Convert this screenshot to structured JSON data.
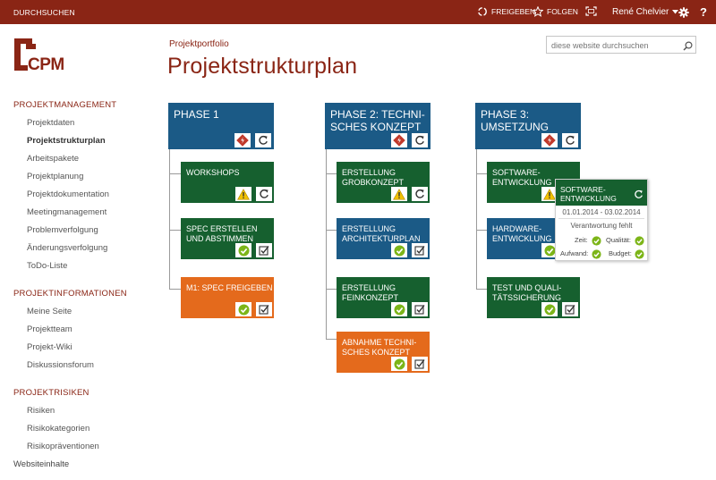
{
  "topbar": {
    "browse_label": "DURCHSUCHEN",
    "share_label": "FREIGEBEN",
    "follow_label": "FOLGEN",
    "user_name": "René Chelvier",
    "help_label": "?"
  },
  "logo": {
    "text": "CPM"
  },
  "header": {
    "breadcrumb": "Projektportfolio",
    "title": "Projektstrukturplan"
  },
  "search": {
    "placeholder": "diese website durchsuchen"
  },
  "nav": {
    "sections": [
      {
        "heading": "PROJEKTMANAGEMENT",
        "items": [
          "Projektdaten",
          "Projektstrukturplan",
          "Arbeitspakete",
          "Projektplanung",
          "Projektdokumentation",
          "Meetingmanagement",
          "Problemverfolgung",
          "Änderungsverfolgung",
          "ToDo-Liste"
        ]
      },
      {
        "heading": "PROJEKTINFORMATIONEN",
        "items": [
          "Meine Seite",
          "Projektteam",
          "Projekt-Wiki",
          "Diskussionsforum"
        ]
      },
      {
        "heading": "PROJEKTRISIKEN",
        "items": [
          "Risiken",
          "Risikokategorien",
          "Risikopräventionen"
        ]
      }
    ],
    "site_contents": "Websiteinhalte"
  },
  "wbs": {
    "phases": [
      {
        "line1": "PHASE 1",
        "line2": "",
        "packages": [
          {
            "line1": "WORKSHOPS",
            "line2": "",
            "color": "green",
            "status": "warning"
          },
          {
            "line1": "SPEC ERSTELLEN",
            "line2": "UND ABSTIMMEN",
            "color": "green",
            "status": "check"
          },
          {
            "line1": "M1: SPEC FREIGEBEN",
            "line2": "",
            "color": "orange",
            "status": "check"
          }
        ]
      },
      {
        "line1": "PHASE 2: TECHNI-",
        "line2": "SCHES KONZEPT",
        "packages": [
          {
            "line1": "ERSTELLUNG",
            "line2": "GROBKONZEPT",
            "color": "green",
            "status": "warning"
          },
          {
            "line1": "ERSTELLUNG",
            "line2": "ARCHITEKTURPLAN",
            "color": "blue",
            "status": "check"
          },
          {
            "line1": "ERSTELLUNG",
            "line2": "FEINKONZEPT",
            "color": "green",
            "status": "check"
          },
          {
            "line1": "ABNAHME TECHNI-",
            "line2": "SCHES KONZEPT",
            "color": "orange",
            "status": "check"
          }
        ]
      },
      {
        "line1": "PHASE 3:",
        "line2": "UMSETZUNG",
        "packages": [
          {
            "line1": "SOFTWARE-",
            "line2": "ENTWICKLUNG",
            "color": "green",
            "status": "warning"
          },
          {
            "line1": "HARDWARE-",
            "line2": "ENTWICKLUNG",
            "color": "blue",
            "status": "check"
          },
          {
            "line1": "TEST UND QUALI-",
            "line2": "TÄTSSICHERUNG",
            "color": "green",
            "status": "check"
          }
        ]
      }
    ]
  },
  "popup": {
    "title_line1": "SOFTWARE-",
    "title_line2": "ENTWICKLUNG",
    "dates": "01.01.2014 - 03.02.2014",
    "responsibility": "Verantwortung fehlt",
    "time_label": "Zeit:",
    "quality_label": "Qualität:",
    "effort_label": "Aufwand:",
    "budget_label": "Budget:"
  },
  "colors": {
    "brand": "#8a2515",
    "blue": "#1b5a86",
    "green": "#16602f",
    "orange": "#e46a1c",
    "check": "#7cb518",
    "warning": "#f2c200"
  }
}
